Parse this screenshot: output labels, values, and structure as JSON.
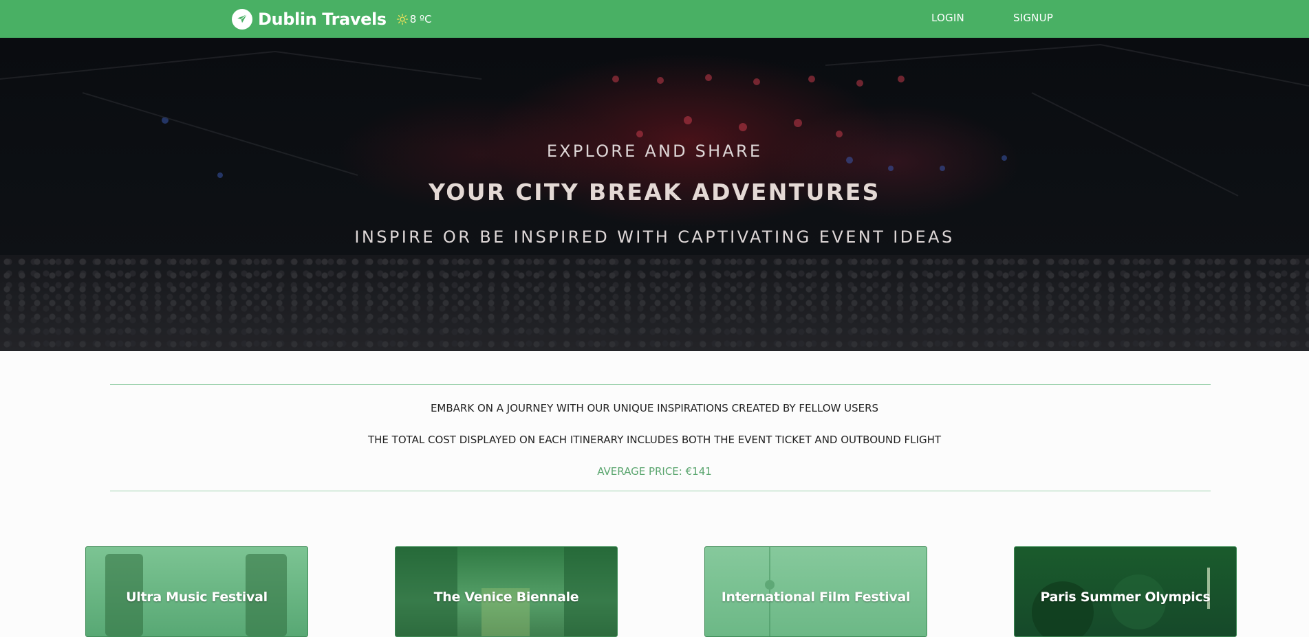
{
  "navbar": {
    "brand": "Dublin Travels",
    "weather_temp": "8 ºC",
    "weather_icon": "sun-icon",
    "logo_icon": "plane-icon",
    "links": {
      "login": "LOGIN",
      "signup": "SIGNUP"
    },
    "color": "#49b064"
  },
  "hero": {
    "line1": "EXPLORE AND SHARE",
    "line2": "YOUR CITY BREAK ADVENTURES",
    "line3": "INSPIRE OR BE INSPIRED WITH CAPTIVATING EVENT IDEAS"
  },
  "info": {
    "line1": "EMBARK ON A JOURNEY WITH OUR UNIQUE INSPIRATIONS CREATED BY FELLOW USERS",
    "line2": "THE TOTAL COST DISPLAYED ON EACH ITINERARY INCLUDES BOTH THE EVENT TICKET AND OUTBOUND FLIGHT",
    "average_price": "AVERAGE PRICE: €141",
    "accent_color": "#5aa56e"
  },
  "cards": [
    {
      "title": "Ultra Music Festival"
    },
    {
      "title": "The Venice Biennale"
    },
    {
      "title": "International Film Festival"
    },
    {
      "title": "Paris Summer Olympics"
    }
  ]
}
